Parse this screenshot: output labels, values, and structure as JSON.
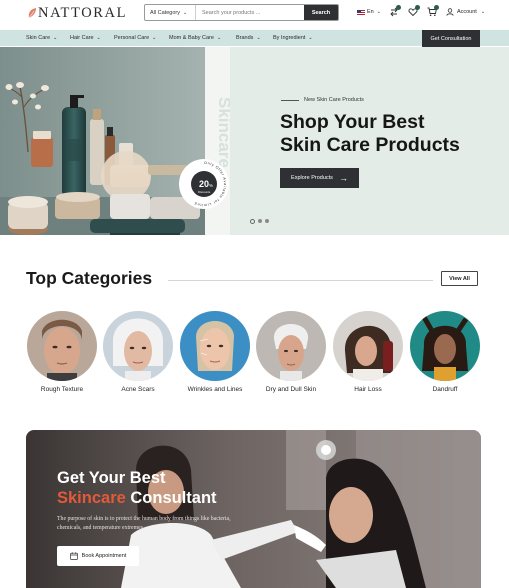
{
  "header": {
    "logo": "NATTORAL",
    "search": {
      "category": "All Category",
      "placeholder": "Search your products ...",
      "button": "Search"
    },
    "language": "En",
    "account": "Account"
  },
  "nav": {
    "items": [
      {
        "label": "Skin Care"
      },
      {
        "label": "Hair Care"
      },
      {
        "label": "Personal Care"
      },
      {
        "label": "Mom & Baby Care"
      },
      {
        "label": "Brands"
      },
      {
        "label": "By Ingredient"
      }
    ],
    "cta": "Get Consultation"
  },
  "hero": {
    "eyebrow": "New Skin Care Products",
    "title_line1": "Shop Your Best",
    "title_line2": "Skin Care Products",
    "button": "Explore Products",
    "vertical_text": "Skincare",
    "offer_percent": "20",
    "offer_unit": "%",
    "offer_sub": "Discounts",
    "offer_ring": "Only Offer Available for Limited"
  },
  "categories": {
    "title": "Top Categories",
    "view_all": "View All",
    "items": [
      {
        "label": "Rough Texture"
      },
      {
        "label": "Acne Scars"
      },
      {
        "label": "Wrinkles and Lines"
      },
      {
        "label": "Dry and Dull Skin"
      },
      {
        "label": "Hair Loss"
      },
      {
        "label": "Dandruff"
      }
    ]
  },
  "banner": {
    "title_line1": "Get Your Best",
    "title_accent": "Skincare",
    "title_rest": " Consultant",
    "description": "The purpose of skin is to protect the human body from things like bacteria, chemicals, and temperature extremes.",
    "button": "Book Appointment"
  },
  "colors": {
    "dark": "#2f3033",
    "nav_bg": "#cfe3e1",
    "hero_bg": "#e3ece7",
    "accent": "#e25a3a"
  },
  "icons": [
    "leaf-icon",
    "chevron-down-icon",
    "flag-icon",
    "compare-icon",
    "heart-icon",
    "cart-icon",
    "user-icon",
    "arrow-right-icon",
    "calendar-icon"
  ]
}
